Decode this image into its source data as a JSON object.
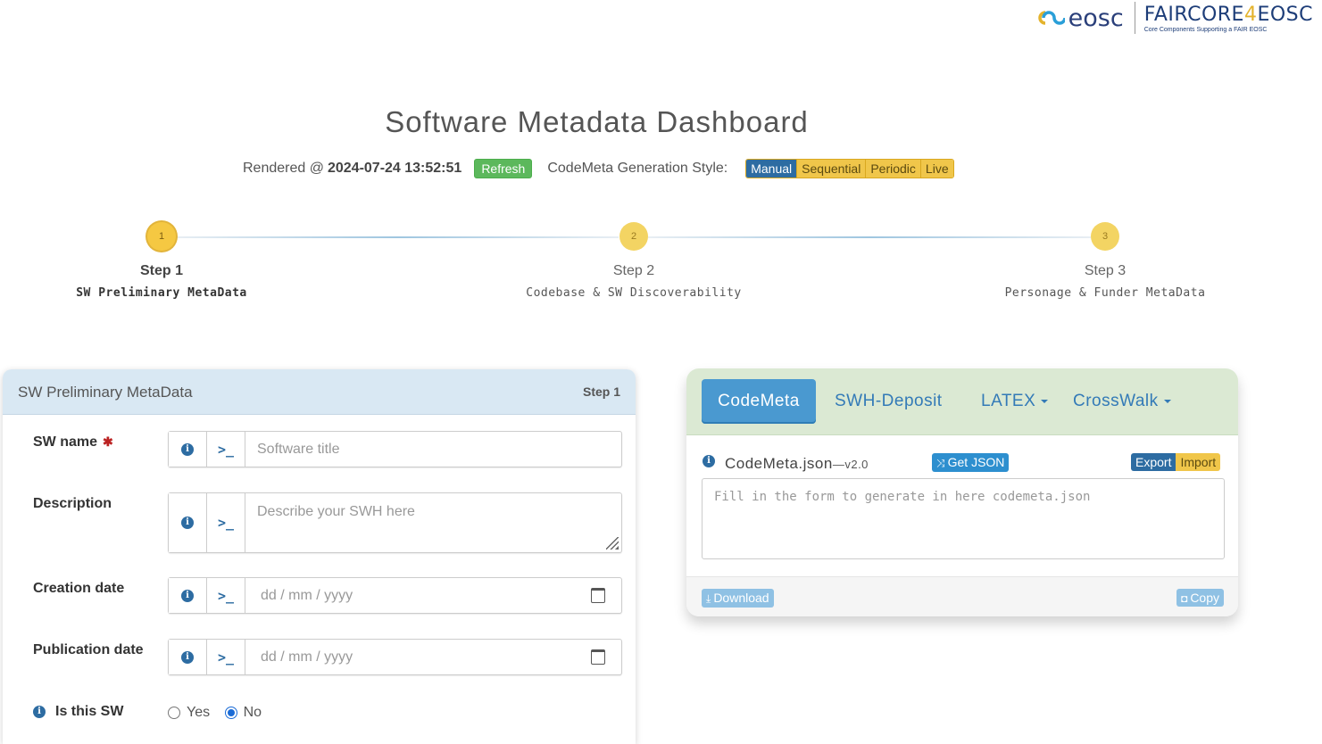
{
  "header": {
    "eosc_text": "eosc",
    "fc_name_a": "FAIRCORE",
    "fc_name_b": "4",
    "fc_name_c": "EOSC",
    "fc_sub": "Core Components Supporting a FAIR EOSC",
    "title": "Software Metadata Dashboard",
    "rendered_label": "Rendered @",
    "rendered_value": "2024-07-24 13:52:51",
    "refresh_label": "Refresh",
    "style_label": "CodeMeta Generation Style:",
    "styles": [
      "Manual",
      "Sequential",
      "Periodic",
      "Live"
    ]
  },
  "steps": [
    {
      "num": "1",
      "title": "Step 1",
      "subtitle": "SW Preliminary MetaData"
    },
    {
      "num": "2",
      "title": "Step 2",
      "subtitle": "Codebase & SW Discoverability"
    },
    {
      "num": "3",
      "title": "Step 3",
      "subtitle": "Personage & Funder MetaData"
    }
  ],
  "left_panel": {
    "title": "SW Preliminary MetaData",
    "step": "Step 1",
    "fields": {
      "sw_name": {
        "label": "SW name",
        "required": "✱",
        "placeholder": "Software title"
      },
      "description": {
        "label": "Description",
        "placeholder": "Describe your SWH here"
      },
      "creation_date": {
        "label": "Creation date",
        "placeholder": "dd / mm / yyyy"
      },
      "publication_date": {
        "label": "Publication date",
        "placeholder": "dd / mm / yyyy"
      },
      "is_sw": {
        "label": "Is this SW",
        "yes": "Yes",
        "no": "No",
        "selected": "No"
      }
    },
    "term_glyph": ">_"
  },
  "right_panel": {
    "tabs": {
      "codemeta": "CodeMeta",
      "swh_deposit": "SWH-Deposit",
      "latex": "LATEX",
      "crosswalk": "CrossWalk"
    },
    "file_title": "CodeMeta.json",
    "version": "—v2.0",
    "get_json": "Get JSON",
    "export": "Export",
    "import": "Import",
    "placeholder": "Fill in the form to generate in here codemeta.json",
    "download": "Download",
    "copy": "Copy"
  },
  "colors": {
    "accent_blue": "#2d6ca2",
    "step_yellow": "#f3d463",
    "refresh_green": "#5cb85c",
    "panel_green": "#dbe9d3",
    "panel_blue": "#d9e8f3"
  }
}
